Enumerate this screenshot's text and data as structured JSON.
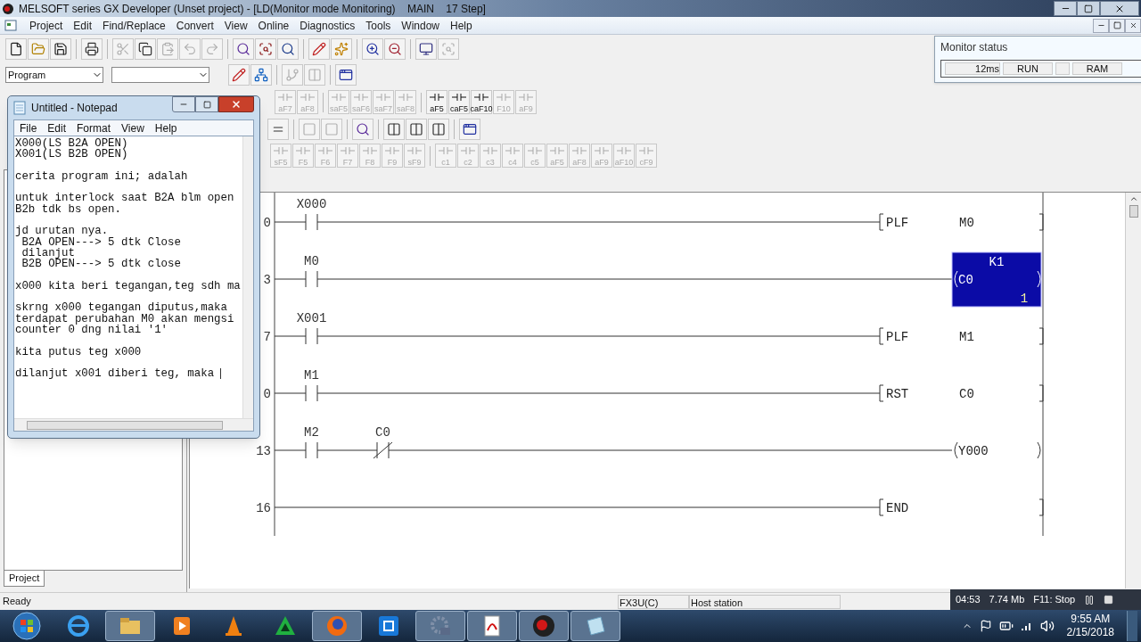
{
  "window": {
    "title": "MELSOFT series GX Developer (Unset project) - [LD(Monitor mode Monitoring)    MAIN    17 Step]"
  },
  "menu": [
    "Project",
    "Edit",
    "Find/Replace",
    "Convert",
    "View",
    "Online",
    "Diagnostics",
    "Tools",
    "Window",
    "Help"
  ],
  "toolbar_1": [
    {
      "kind": "new",
      "disabled": false
    },
    {
      "kind": "open",
      "disabled": false
    },
    {
      "kind": "save",
      "disabled": false
    },
    {
      "kind": "sep"
    },
    {
      "kind": "print",
      "disabled": false
    },
    {
      "kind": "sep"
    },
    {
      "kind": "cut",
      "disabled": true
    },
    {
      "kind": "copy",
      "disabled": false
    },
    {
      "kind": "paste",
      "disabled": true
    },
    {
      "kind": "undo",
      "disabled": true
    },
    {
      "kind": "redo",
      "disabled": true
    },
    {
      "kind": "sep"
    },
    {
      "kind": "find",
      "disabled": false
    },
    {
      "kind": "scan",
      "disabled": false
    },
    {
      "kind": "search",
      "disabled": false
    },
    {
      "kind": "sep"
    },
    {
      "kind": "write",
      "disabled": false
    },
    {
      "kind": "spark",
      "disabled": false
    },
    {
      "kind": "sep"
    },
    {
      "kind": "zoomin",
      "disabled": false
    },
    {
      "kind": "zoomout",
      "disabled": false
    },
    {
      "kind": "sep"
    },
    {
      "kind": "monitor",
      "disabled": false
    },
    {
      "kind": "scan",
      "disabled": true
    }
  ],
  "program_select": {
    "value": "Program"
  },
  "toolbar_2": [
    {
      "kind": "write",
      "disabled": false
    },
    {
      "kind": "tree",
      "disabled": false
    },
    {
      "kind": "sep"
    },
    {
      "kind": "branch",
      "disabled": true
    },
    {
      "kind": "columns",
      "disabled": true
    },
    {
      "kind": "sep"
    },
    {
      "kind": "window",
      "disabled": false
    }
  ],
  "toolbar_3": [
    {
      "label": "aF7",
      "disabled": true
    },
    {
      "label": "aF8",
      "disabled": true
    },
    {
      "kind": "sep"
    },
    {
      "label": "saF5",
      "disabled": true
    },
    {
      "label": "saF6",
      "disabled": true
    },
    {
      "label": "saF7",
      "disabled": true
    },
    {
      "label": "saF8",
      "disabled": true
    },
    {
      "kind": "sep"
    },
    {
      "label": "aF5",
      "disabled": false
    },
    {
      "label": "caF5",
      "disabled": false
    },
    {
      "label": "caF10",
      "disabled": false
    },
    {
      "label": "F10",
      "disabled": true
    },
    {
      "label": "aF9",
      "disabled": true
    }
  ],
  "toolbar_4": [
    {
      "kind": "equal",
      "disabled": false
    },
    {
      "kind": "sep"
    },
    {
      "kind": "square",
      "disabled": true
    },
    {
      "kind": "square",
      "disabled": true
    },
    {
      "kind": "sep"
    },
    {
      "kind": "find",
      "disabled": false
    },
    {
      "kind": "sep"
    },
    {
      "kind": "columns",
      "disabled": false
    },
    {
      "kind": "columns",
      "disabled": false
    },
    {
      "kind": "columns",
      "disabled": false
    },
    {
      "kind": "sep"
    },
    {
      "kind": "window",
      "disabled": false
    }
  ],
  "toolbar_5": [
    {
      "label": "sF5",
      "disabled": true
    },
    {
      "label": "F5",
      "disabled": true
    },
    {
      "label": "F6",
      "disabled": true
    },
    {
      "label": "F7",
      "disabled": true
    },
    {
      "label": "F8",
      "disabled": true
    },
    {
      "label": "F9",
      "disabled": true
    },
    {
      "label": "sF9",
      "disabled": true
    },
    {
      "kind": "sep"
    },
    {
      "label": "c1",
      "disabled": true
    },
    {
      "label": "c2",
      "disabled": true
    },
    {
      "label": "c3",
      "disabled": true
    },
    {
      "label": "c4",
      "disabled": true
    },
    {
      "label": "c5",
      "disabled": true
    },
    {
      "label": "aF5",
      "disabled": true
    },
    {
      "label": "aF8",
      "disabled": true
    },
    {
      "label": "aF9",
      "disabled": true
    },
    {
      "label": "aF10",
      "disabled": true
    },
    {
      "label": "cF9",
      "disabled": true
    }
  ],
  "monitor_status": {
    "title": "Monitor status",
    "fields": [
      {
        "kind": "value",
        "text": "12ms"
      },
      {
        "kind": "value",
        "text": "RUN"
      },
      {
        "kind": "blank"
      },
      {
        "kind": "value",
        "text": "RAM"
      }
    ]
  },
  "ladder": {
    "rungs": [
      {
        "step": "0",
        "contacts": [
          {
            "label": "X000",
            "kind": "no"
          }
        ],
        "instruction": {
          "kind": "bracket",
          "op": "PLF",
          "operand": "M0",
          "selected": false
        }
      },
      {
        "step": "3",
        "contacts": [
          {
            "label": "M0",
            "kind": "no"
          }
        ],
        "instruction": {
          "kind": "coil",
          "op": "C0",
          "setting": "K1",
          "current": "1",
          "selected": true
        }
      },
      {
        "step": "7",
        "contacts": [
          {
            "label": "X001",
            "kind": "no"
          }
        ],
        "instruction": {
          "kind": "bracket",
          "op": "PLF",
          "operand": "M1",
          "selected": false
        }
      },
      {
        "step": "0",
        "contacts": [
          {
            "label": "M1",
            "kind": "no"
          }
        ],
        "instruction": {
          "kind": "bracket",
          "op": "RST",
          "operand": "C0",
          "selected": false
        }
      },
      {
        "step": "13",
        "contacts": [
          {
            "label": "M2",
            "kind": "no"
          },
          {
            "label": "C0",
            "kind": "nc"
          }
        ],
        "instruction": {
          "kind": "coil",
          "op": "Y000",
          "selected": false
        }
      },
      {
        "step": "16",
        "instruction": {
          "kind": "bracket",
          "op": "END",
          "selected": false
        }
      }
    ]
  },
  "project_tab": {
    "label": "Project",
    "selected": true
  },
  "status_bar": {
    "text": "Ready",
    "cells": [
      "FX3U(C)",
      "Host station"
    ]
  },
  "recorder": {
    "elapsed": "04:53",
    "size": "7.74 Mb",
    "hint": "F11: Stop"
  },
  "notepad": {
    "title": "Untitled - Notepad",
    "menu": [
      "File",
      "Edit",
      "Format",
      "View",
      "Help"
    ],
    "paragraphs": [
      [
        "X000(LS B2A OPEN)",
        "X001(LS B2B OPEN)"
      ],
      [
        "cerita program ini; adalah"
      ],
      [
        "untuk interlock saat B2A blm open",
        "B2b tdk bs open."
      ],
      [
        "jd urutan nya.",
        " B2A OPEN---> 5 dtk Close",
        " dilanjut",
        " B2B OPEN---> 5 dtk close"
      ],
      [
        "x000 kita beri tegangan,teg sdh ma"
      ],
      [
        "skrng x000 tegangan diputus,maka",
        "terdapat perubahan M0 akan mengsi",
        "counter 0 dng nilai '1'"
      ],
      [
        "kita putus teg x000"
      ],
      [
        "dilanjut x001 diberi teg, maka"
      ]
    ]
  },
  "taskbar": {
    "apps": [
      {
        "kind": "ie",
        "active": false
      },
      {
        "kind": "explorer",
        "active": true
      },
      {
        "kind": "media",
        "active": false
      },
      {
        "kind": "vlc",
        "active": false
      },
      {
        "kind": "triangle",
        "active": false
      },
      {
        "kind": "firefox",
        "active": true
      },
      {
        "kind": "capture",
        "active": false
      },
      {
        "kind": "gear",
        "active": true
      },
      {
        "kind": "acrobat",
        "active": true
      },
      {
        "kind": "gx",
        "active": true
      },
      {
        "kind": "notepad",
        "active": true
      }
    ],
    "time": "9:55 AM",
    "date": "2/15/2018"
  }
}
